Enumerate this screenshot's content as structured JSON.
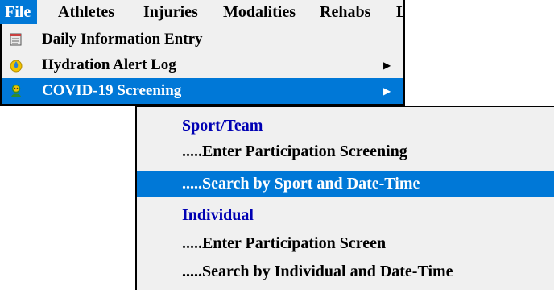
{
  "menubar": {
    "items": [
      {
        "label": "File",
        "active": true
      },
      {
        "label": "Athletes"
      },
      {
        "label": "Injuries"
      },
      {
        "label": "Modalities"
      },
      {
        "label": "Rehabs"
      },
      {
        "label": "L"
      }
    ]
  },
  "file_menu": {
    "items": [
      {
        "label": "Daily Information Entry",
        "icon": "notepad-icon",
        "has_submenu": false
      },
      {
        "label": "Hydration Alert Log",
        "icon": "water-drop-icon",
        "has_submenu": true
      },
      {
        "label": "COVID-19 Screening",
        "icon": "person-screening-icon",
        "has_submenu": true,
        "highlighted": true
      }
    ],
    "submenu_arrow": "▶"
  },
  "covid_submenu": {
    "items": [
      {
        "label": "Sport/Team",
        "type": "header"
      },
      {
        "label": ".....Enter Participation Screening",
        "type": "item"
      },
      {
        "label": ".....Search by Sport and Date-Time",
        "type": "item",
        "highlighted": true
      },
      {
        "label": "Individual",
        "type": "header"
      },
      {
        "label": ".....Enter Participation Screen",
        "type": "item"
      },
      {
        "label": ".....Search by Individual and Date-Time",
        "type": "item"
      }
    ]
  },
  "colors": {
    "menu_background": "#f0f0f0",
    "highlight": "#0078d7",
    "header_text": "#0000b3",
    "border": "#000000"
  }
}
